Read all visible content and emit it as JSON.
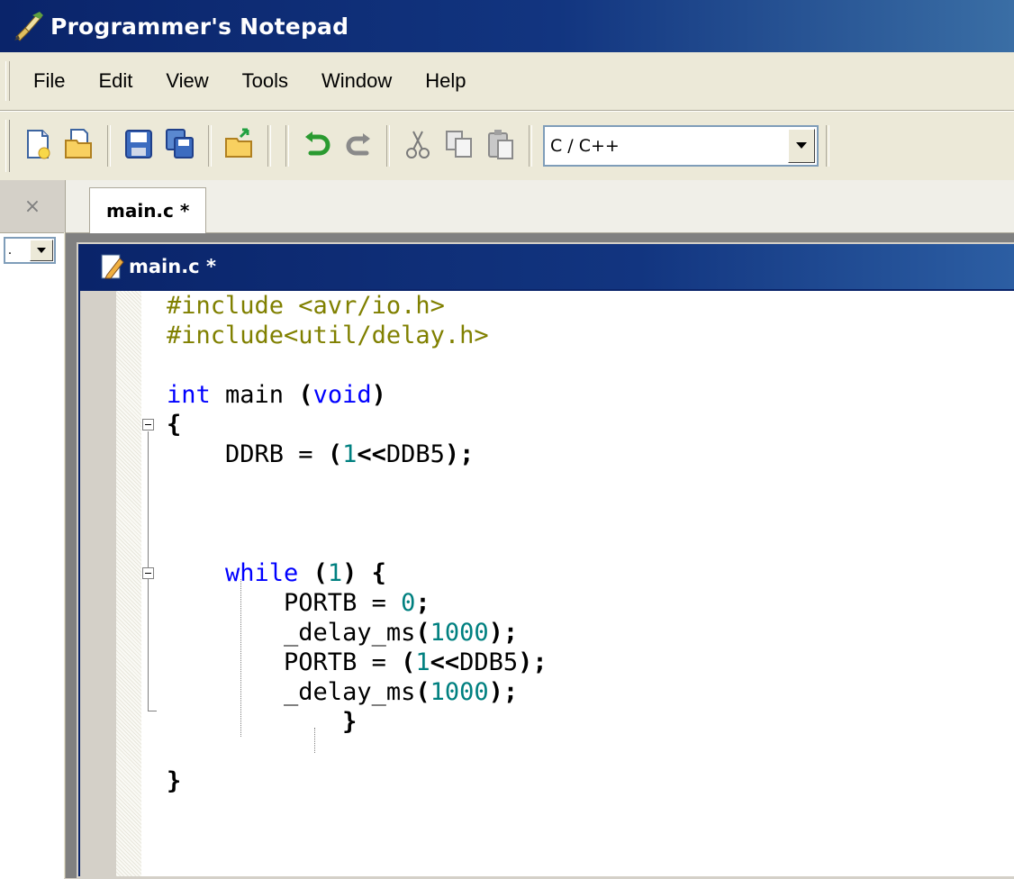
{
  "window": {
    "title": "Programmer's Notepad"
  },
  "menu": [
    "File",
    "Edit",
    "View",
    "Tools",
    "Window",
    "Help"
  ],
  "toolbar": {
    "buttons": [
      "new-file-icon",
      "open-file-icon",
      "save-icon",
      "save-all-icon",
      "open-project-icon",
      "undo-icon",
      "redo-icon",
      "cut-icon",
      "copy-icon",
      "paste-icon"
    ],
    "scheme_value": "C / C++"
  },
  "left_pane": {
    "close_glyph": "×",
    "combo_value": "."
  },
  "tabs": [
    {
      "label": "main.c *"
    }
  ],
  "document": {
    "title": "main.c *",
    "lines": [
      "#include <avr/io.h>",
      "#include<util/delay.h>",
      "",
      "int main (void)",
      "{",
      "    DDRB = (1<<DDB5);",
      "",
      "",
      "",
      "    while (1) {",
      "        PORTB = 0;",
      "        _delay_ms(1000);",
      "        PORTB = (1<<DDB5);",
      "        _delay_ms(1000);",
      "            }",
      "",
      "}"
    ]
  },
  "colors": {
    "title_bar": "#0a246a",
    "keyword": "#0000ff",
    "preprocessor": "#808000",
    "number": "#008080"
  }
}
